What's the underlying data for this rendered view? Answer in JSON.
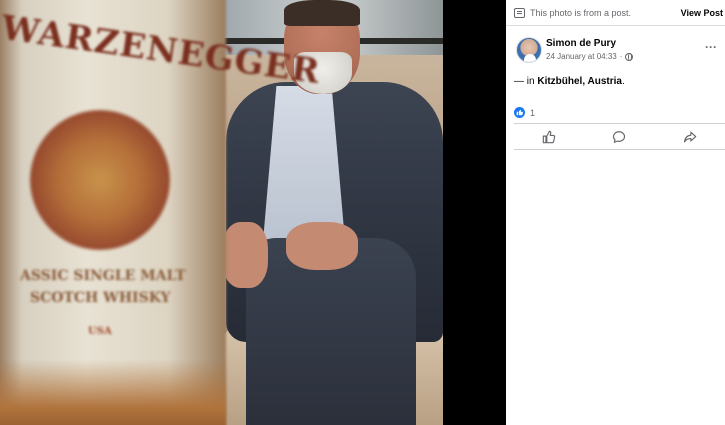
{
  "notice": {
    "text": "This photo is from a post.",
    "view_post_label": "View Post"
  },
  "post": {
    "author": "Simon de Pury",
    "timestamp": "24 January at 04:33",
    "separator": "·",
    "audience_icon": "globe-icon",
    "location_prefix": "— in ",
    "location": "Kitzbühel, Austria",
    "location_suffix": ".",
    "reaction_count": "1",
    "reaction_icon": "like-icon"
  },
  "actions": [
    {
      "icon": "like-icon"
    },
    {
      "icon": "comment-icon"
    },
    {
      "icon": "share-icon"
    }
  ],
  "photo": {
    "label_text_1": "WARZENEGGER",
    "label_text_2": "ASSIC SINGLE MALT",
    "label_text_3": "SCOTCH WHISKY",
    "label_text_4": "USA"
  },
  "colors": {
    "accent": "#1877f2",
    "secondary_text": "#65676b",
    "primary_text": "#050505",
    "divider": "#ced0d4"
  }
}
